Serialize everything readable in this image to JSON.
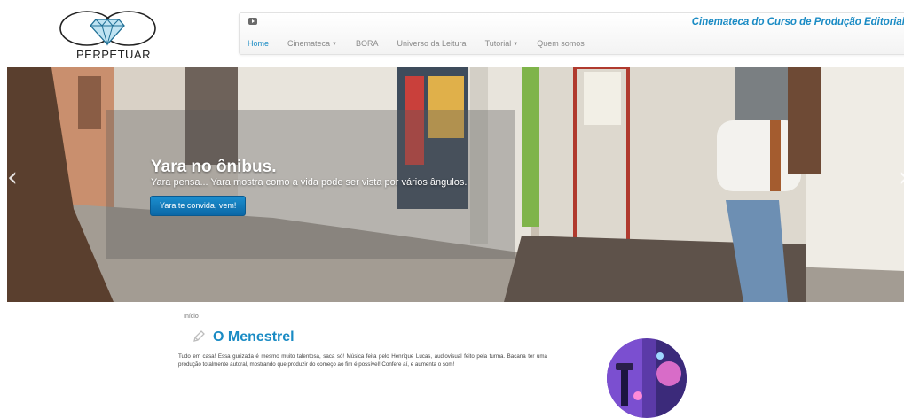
{
  "header": {
    "logo_text": "PERPETUAR",
    "site_title": "Cinemateca do Curso de Produção Editorial",
    "nav": [
      {
        "label": "Home",
        "active": true,
        "has_caret": false
      },
      {
        "label": "Cinemateca",
        "active": false,
        "has_caret": true
      },
      {
        "label": "BORA",
        "active": false,
        "has_caret": false
      },
      {
        "label": "Universo da Leitura",
        "active": false,
        "has_caret": false
      },
      {
        "label": "Tutorial",
        "active": false,
        "has_caret": true
      },
      {
        "label": "Quem somos",
        "active": false,
        "has_caret": false
      }
    ],
    "icons": {
      "social": "youtube-icon",
      "logo": "diamond-icon"
    }
  },
  "hero": {
    "title": "Yara no ônibus.",
    "subtitle": "Yara pensa... Yara mostra como a vida pode ser vista por vários ângulos.",
    "button_label": "Yara te convida, vem!",
    "prev_arrow": "‹",
    "next_arrow": "›"
  },
  "content": {
    "breadcrumb": "Início",
    "post_title": "O Menestrel",
    "post_body": "Tudo em casa! Essa gurizada é mesmo muito talentosa, saca só! Música feita pelo Henrique Lucas, audiovisual feito pela turma. Bacana ter uma produção totalmente autoral, mostrando que produzir do começo ao fim é possível! Confere aí, e aumenta o som!"
  },
  "colors": {
    "accent": "#1a8bc4",
    "button": "#0e74b5",
    "nav_text": "#8a8a8a"
  }
}
